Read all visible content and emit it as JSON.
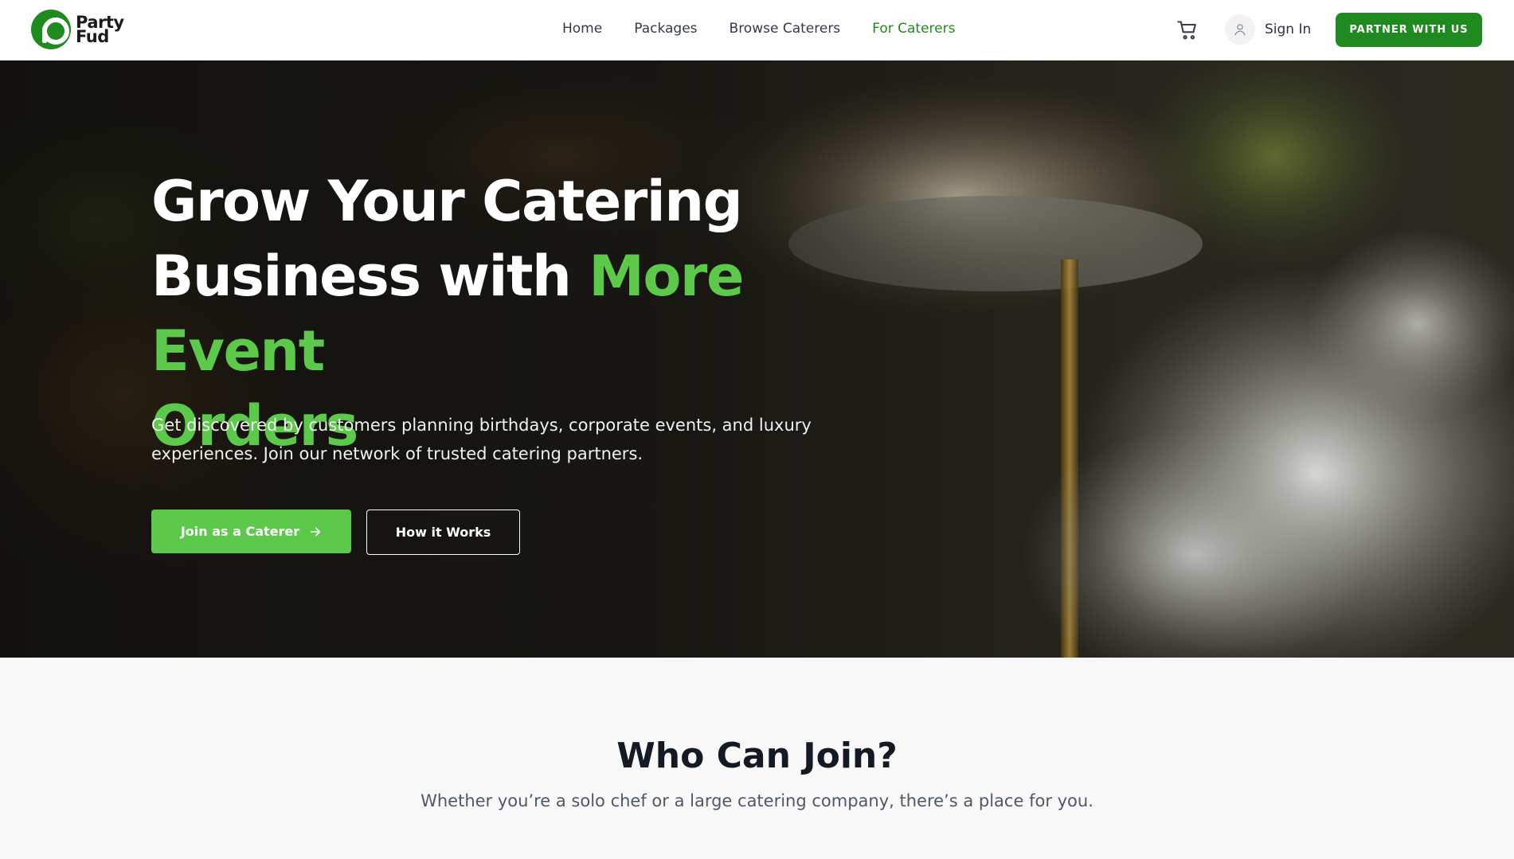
{
  "brand": {
    "line1": "Party",
    "line2": "Fud"
  },
  "nav": {
    "items": [
      {
        "label": "Home"
      },
      {
        "label": "Packages"
      },
      {
        "label": "Browse Caterers"
      },
      {
        "label": "For Caterers"
      }
    ]
  },
  "header": {
    "cart_icon": "cart-icon",
    "user_icon": "user-icon",
    "sign_in_label": "Sign In",
    "partner_button": "PARTNER WITH US"
  },
  "hero": {
    "title_line1": "Grow Your Catering",
    "title_line2_plain": "Business with ",
    "title_line2_accent": "More Event",
    "title_line3_accent": "Orders",
    "subtitle": "Get discovered by customers planning birthdays, corporate events, and luxury experiences. Join our network of trusted catering partners.",
    "primary_button": "Join as a Caterer",
    "secondary_button": "How it Works"
  },
  "who": {
    "title": "Who Can Join?",
    "subtitle": "Whether you’re a solo chef or a large catering company, there’s a place for you."
  },
  "colors": {
    "brand_green": "#1f8a1f",
    "accent_green": "#5cc94a",
    "text_dark": "#141a24"
  }
}
